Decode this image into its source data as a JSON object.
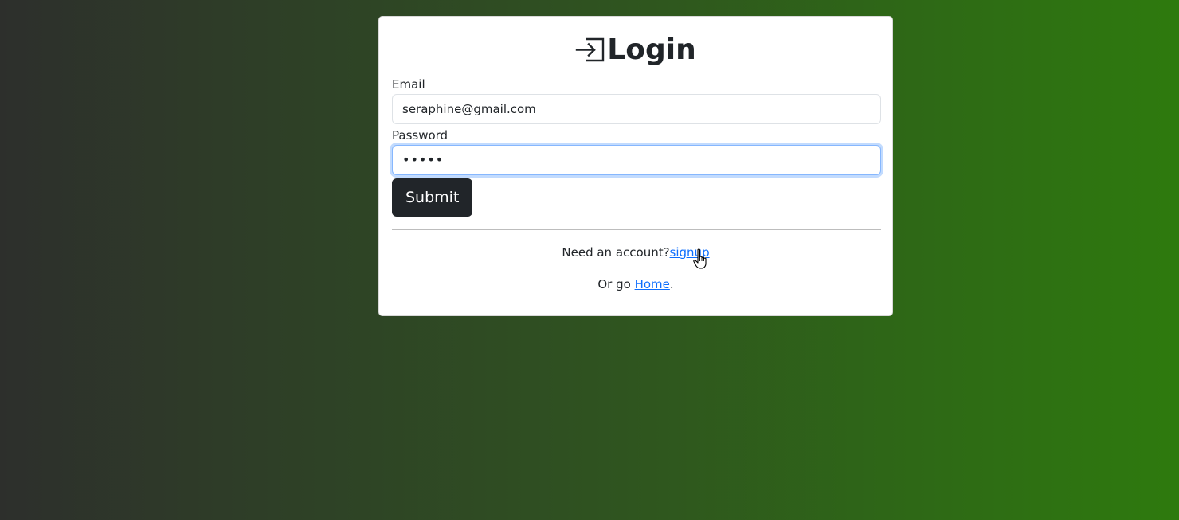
{
  "login": {
    "title": "Login",
    "title_icon": "login-arrow-icon",
    "email_label": "Email",
    "email_value": "seraphine@gmail.com",
    "password_label": "Password",
    "password_value": "•••••",
    "submit_label": "Submit",
    "signup_prompt": "Need an account?",
    "signup_link": "signup",
    "home_prefix": "Or go ",
    "home_link": "Home",
    "home_suffix": "."
  },
  "colors": {
    "background_left": "#2d2f2c",
    "background_right": "#2e7a0e",
    "button": "#212529",
    "link": "#0d6efd",
    "focus_border": "#86b7fe"
  },
  "cursor": "hand-pointer-icon"
}
